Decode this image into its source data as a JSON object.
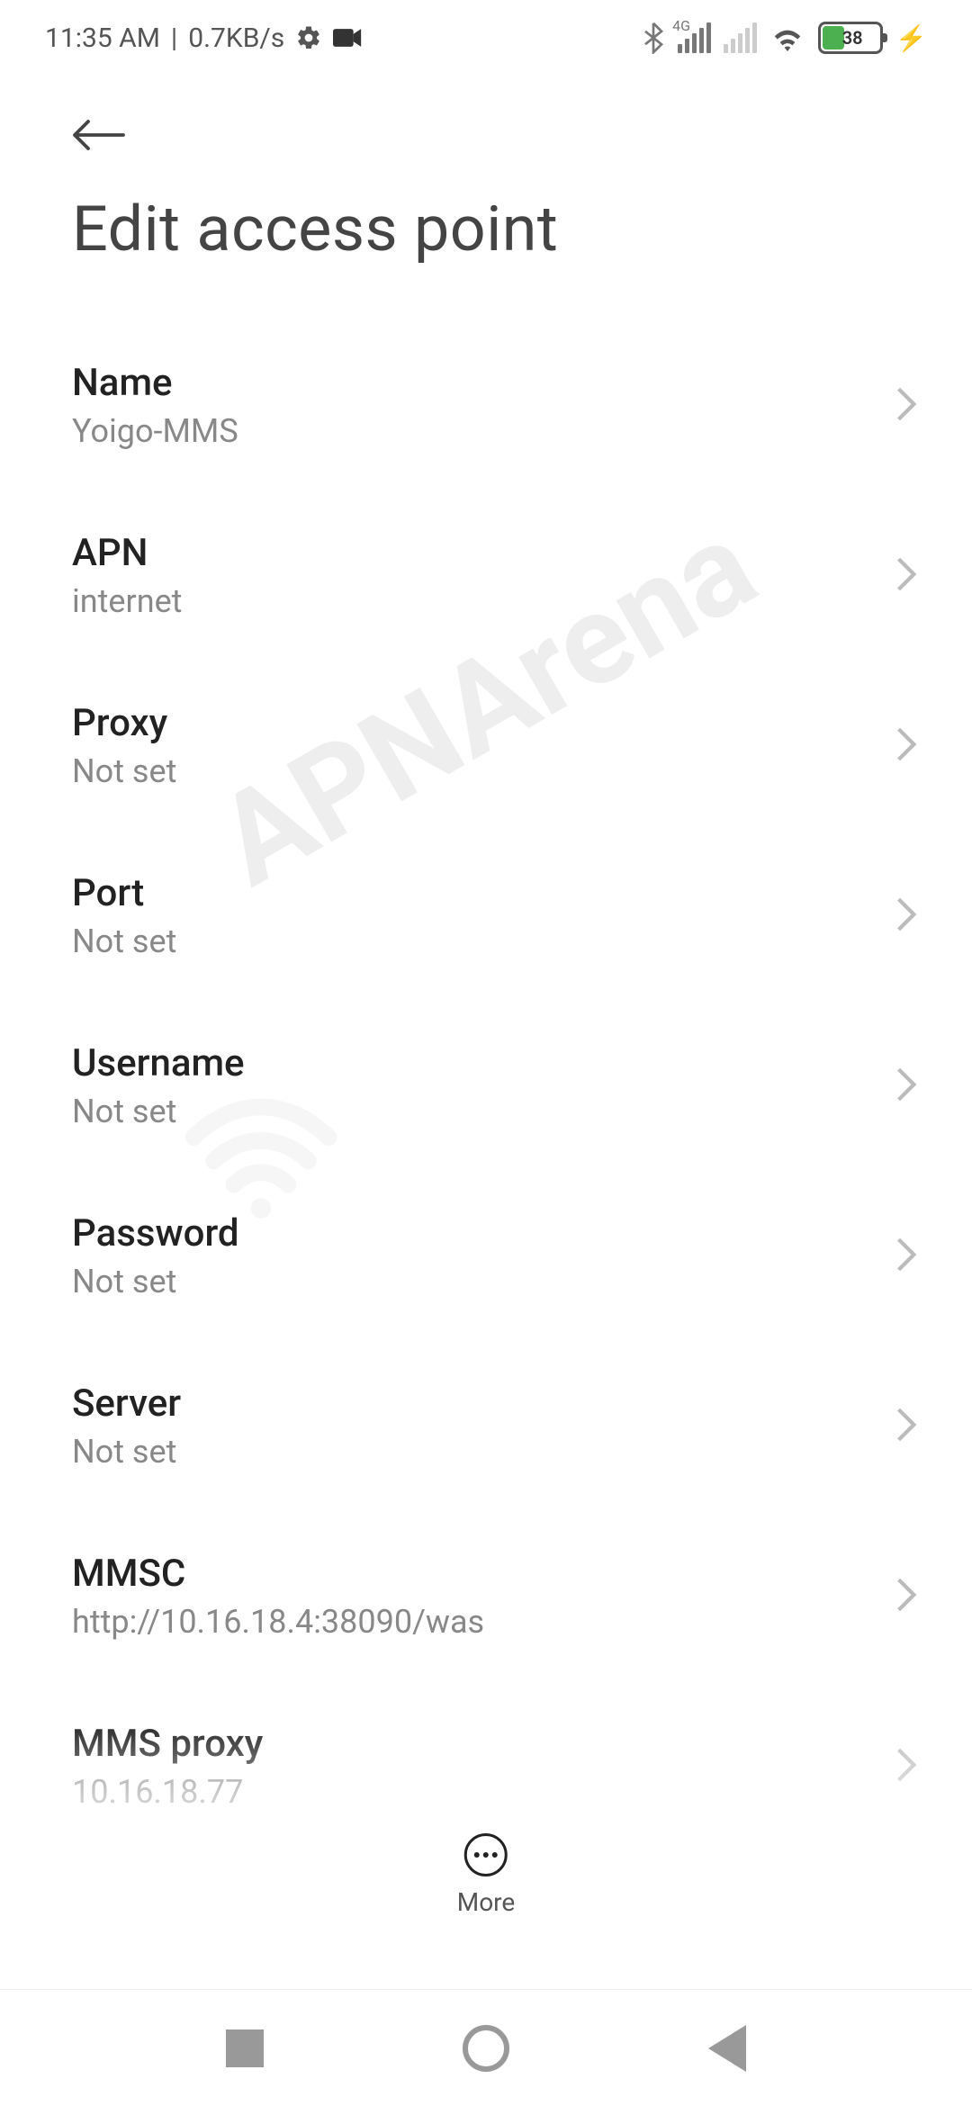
{
  "status_bar": {
    "time": "11:35 AM",
    "speed": "0.7KB/s",
    "signal_label": "4G",
    "battery_percent": "38"
  },
  "header": {
    "title": "Edit access point"
  },
  "settings": [
    {
      "label": "Name",
      "value": "Yoigo-MMS"
    },
    {
      "label": "APN",
      "value": "internet"
    },
    {
      "label": "Proxy",
      "value": "Not set"
    },
    {
      "label": "Port",
      "value": "Not set"
    },
    {
      "label": "Username",
      "value": "Not set"
    },
    {
      "label": "Password",
      "value": "Not set"
    },
    {
      "label": "Server",
      "value": "Not set"
    },
    {
      "label": "MMSC",
      "value": "http://10.16.18.4:38090/was"
    },
    {
      "label": "MMS proxy",
      "value": "10.16.18.77"
    }
  ],
  "more_button": {
    "label": "More"
  },
  "watermark": "APNArena"
}
